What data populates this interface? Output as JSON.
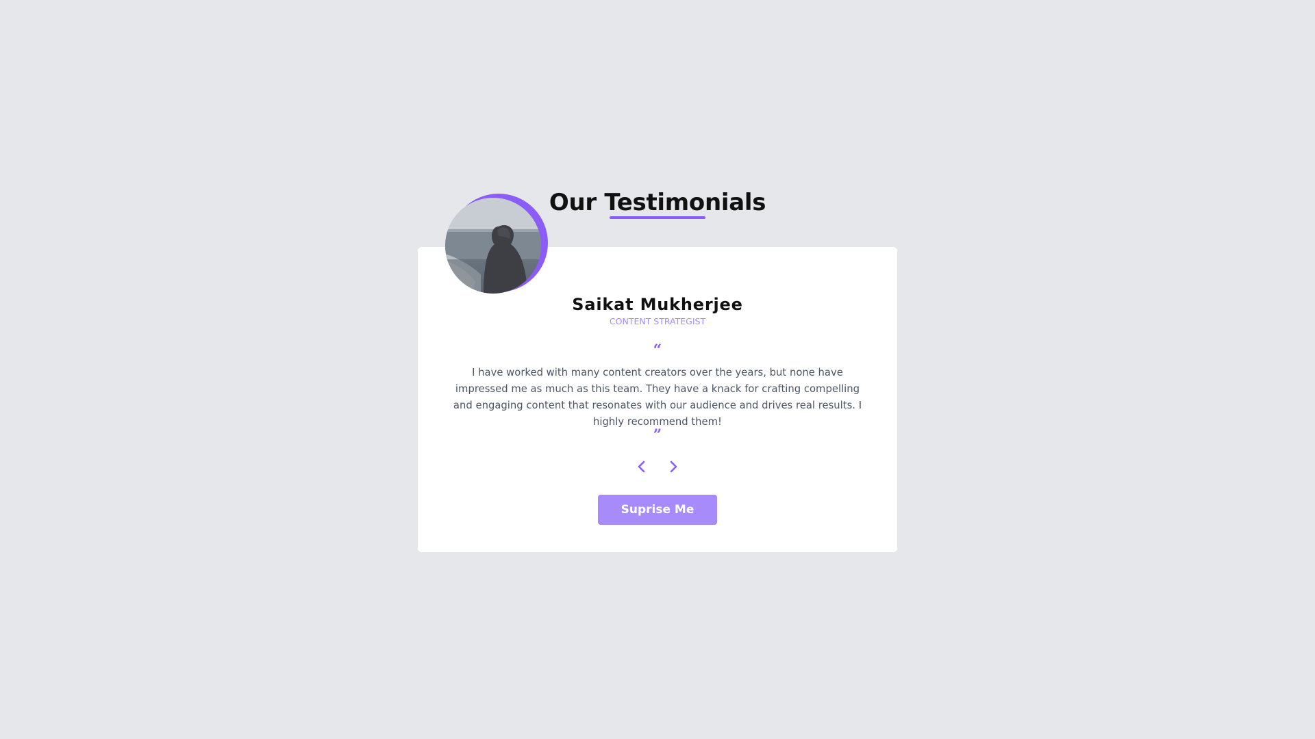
{
  "header": {
    "title": "Our Testimonials"
  },
  "testimonial": {
    "name": "Saikat Mukherjee",
    "role": "CONTENT STRATEGIST",
    "quote_open": "“",
    "text": "I have worked with many content creators over the years, but none have impressed me as much as this team. They have a knack for crafting compelling and engaging content that resonates with our audience and drives real results. I highly recommend them!",
    "quote_close": "”",
    "avatar_icon": "person-photo-icon"
  },
  "nav": {
    "prev_icon": "chevron-left-icon",
    "next_icon": "chevron-right-icon"
  },
  "cta": {
    "label": "Suprise Me"
  },
  "colors": {
    "background": "#e5e7eb",
    "card": "#ffffff",
    "accent": "#8b5cf6",
    "accent_light": "#a78bfa",
    "text": "#4b5563",
    "heading": "#111111"
  }
}
